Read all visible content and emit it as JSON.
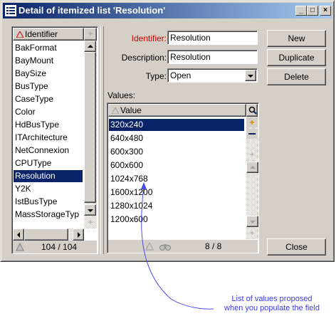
{
  "window": {
    "title": "Detail of itemized list 'Resolution'",
    "controls": [
      "_",
      "□",
      "×"
    ]
  },
  "left_list": {
    "header": "Identifier",
    "items": [
      "BakFormat",
      "BayMount",
      "BaySize",
      "BusType",
      "CaseType",
      "Color",
      "HdBusType",
      "ITArchitecture",
      "NetConnexion",
      "CPUType",
      "Resolution",
      "Y2K",
      "IstBusType",
      "MassStorageTyp"
    ],
    "selected": "Resolution",
    "status": "104 / 104"
  },
  "form": {
    "identifier_label": "Identifier:",
    "identifier_value": "Resolution",
    "description_label": "Description:",
    "description_value": "Resolution",
    "type_label": "Type:",
    "type_value": "Open",
    "values_label": "Values:"
  },
  "values_list": {
    "header": "Value",
    "items": [
      "320x240",
      "640x480",
      "600x300",
      "600x600",
      "1024x768",
      "1600x1200",
      "1280x1024",
      "1200x600"
    ],
    "selected": "320x240",
    "status": "8 / 8"
  },
  "buttons": {
    "new": "New",
    "duplicate": "Duplicate",
    "delete": "Delete",
    "close": "Close"
  },
  "annotation": {
    "line1": "List of values proposed",
    "line2": "when you populate the field"
  },
  "colors": {
    "accent": "#0a246a",
    "identifier_label": "#cc0000",
    "annotation": "#3a3af0"
  }
}
